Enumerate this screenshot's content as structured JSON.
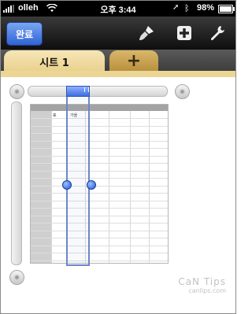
{
  "status_bar": {
    "carrier": "olleh",
    "time": "오후 3:44",
    "battery": "98%",
    "battery_level": 0.98
  },
  "toolbar": {
    "done_label": "완료",
    "icons": [
      "paintbrush-icon",
      "add-icon",
      "wrench-icon"
    ]
  },
  "tabs": {
    "sheet_label": "시트 1",
    "add_label": "+"
  },
  "table": {
    "cell_labels": [
      "표",
      "가을"
    ]
  },
  "colors": {
    "accent": "#3f6fe0",
    "tab_active": "#f1dea6",
    "tab_add": "#c9a150"
  },
  "watermark": {
    "title": "CaN Tips",
    "url": "canlips.com"
  }
}
